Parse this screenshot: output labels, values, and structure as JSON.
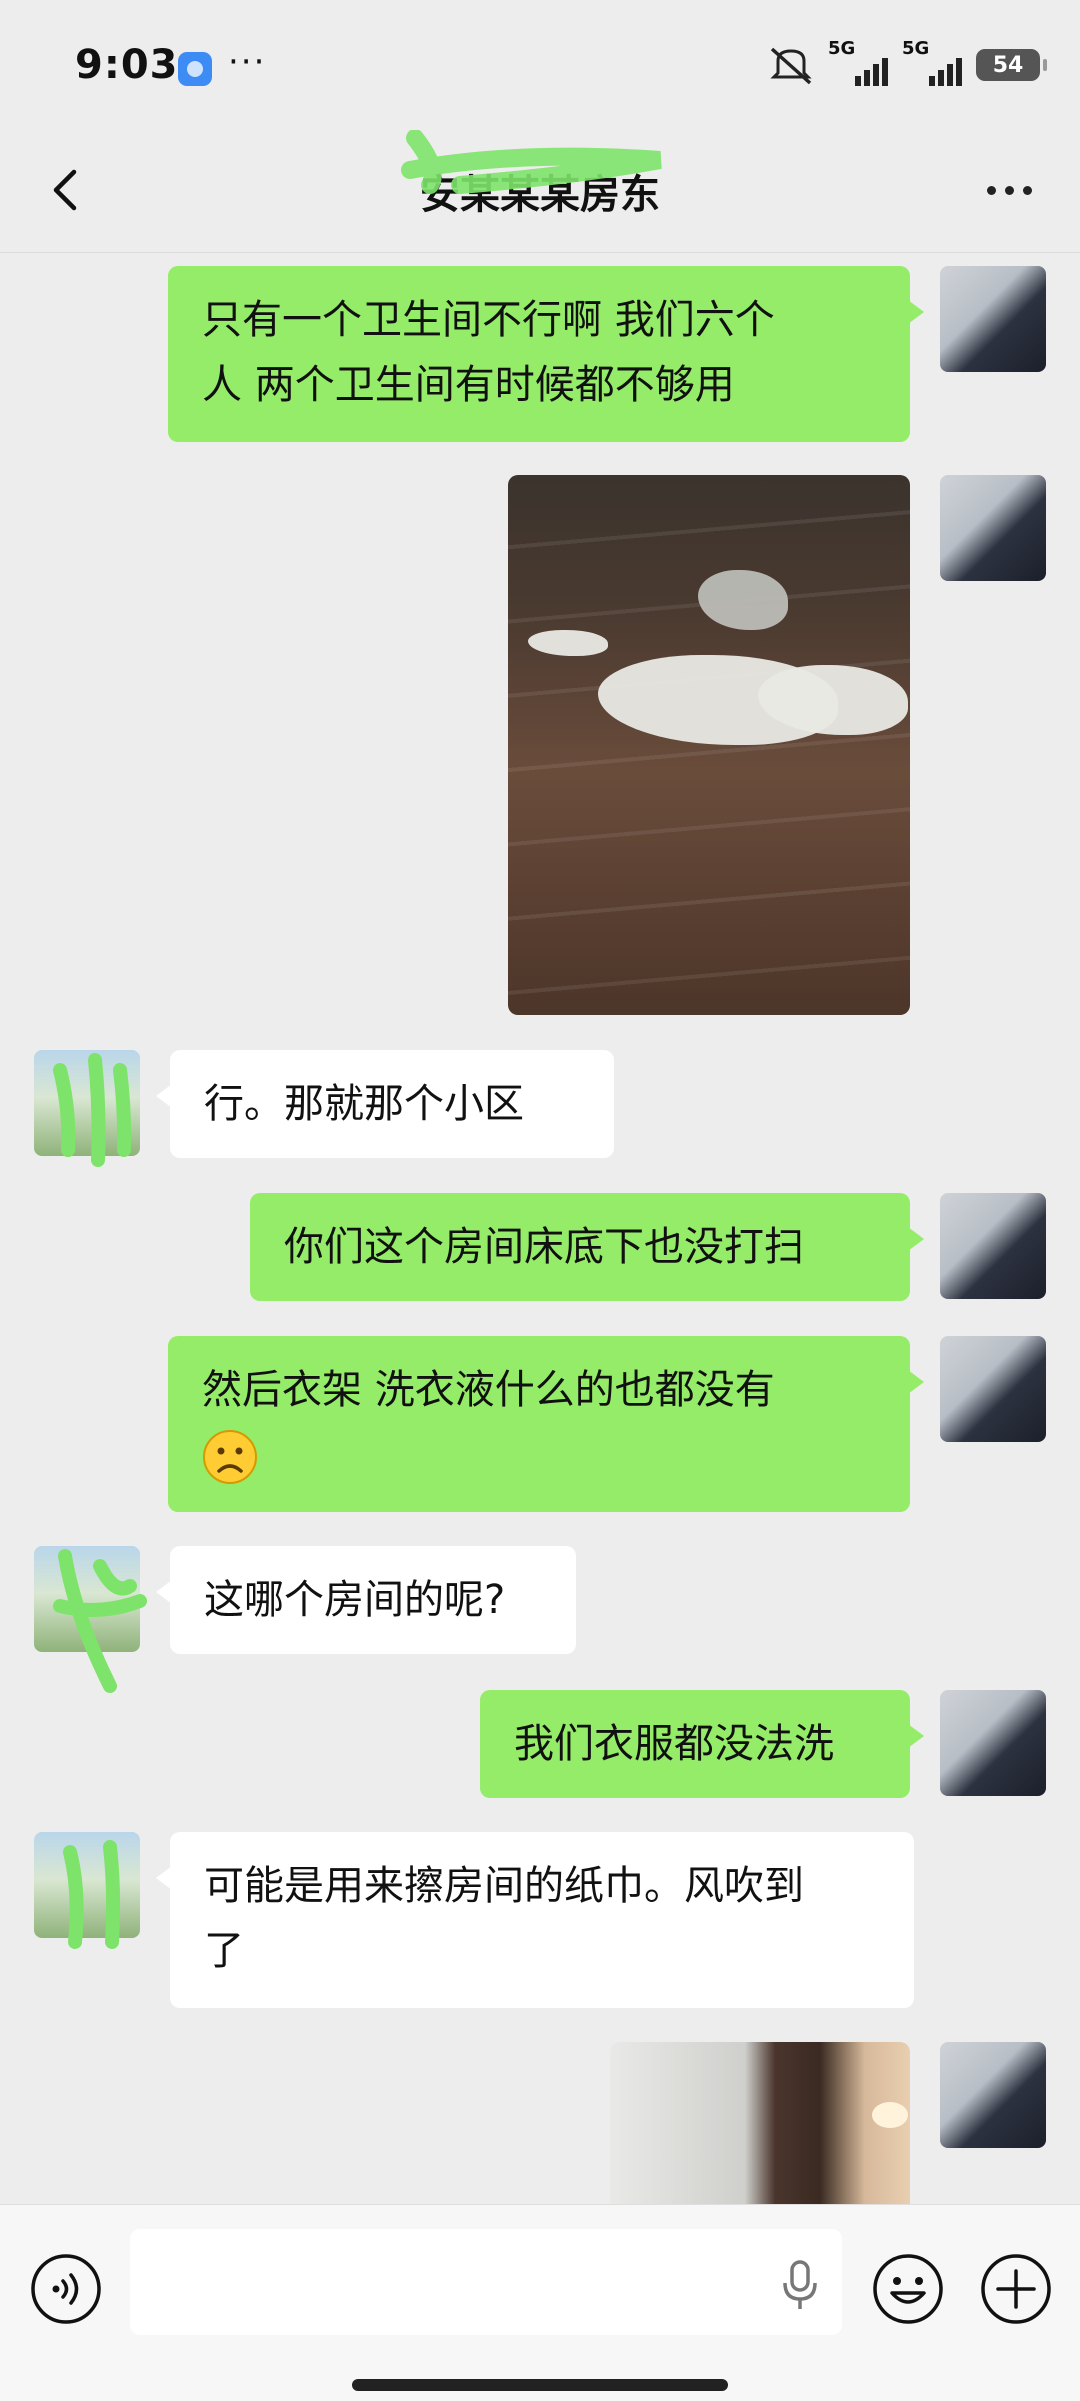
{
  "status_bar": {
    "time": "9:03",
    "overflow": "···",
    "signal1_label": "5G",
    "signal2_label": "5G",
    "battery": "54"
  },
  "header": {
    "title": "安某某某房东",
    "back_icon": "chevron-left-icon",
    "menu_icon": "more-horizontal-icon"
  },
  "messages": [
    {
      "side": "me",
      "type": "text",
      "line1": "只有一个卫生间不行啊 我们六个",
      "line2": "人 两个卫生间有时候都不够用"
    },
    {
      "side": "me",
      "type": "image",
      "subject": "tissue scraps on wooden floor"
    },
    {
      "side": "other",
      "type": "text",
      "text": "行。那就那个小区"
    },
    {
      "side": "me",
      "type": "text",
      "text": "你们这个房间床底下也没打扫"
    },
    {
      "side": "me",
      "type": "text",
      "line1": "然后衣架 洗衣液什么的也都没有",
      "emoji": "frowning-face-icon"
    },
    {
      "side": "other",
      "type": "text",
      "text": "这哪个房间的呢?"
    },
    {
      "side": "me",
      "type": "text",
      "text": "我们衣服都没法洗"
    },
    {
      "side": "other",
      "type": "text",
      "line1": "可能是用来擦房间的纸巾。风吹到",
      "line2": "了"
    },
    {
      "side": "me",
      "type": "image",
      "subject": "room interior"
    }
  ],
  "input_bar": {
    "voice_icon": "voice-mode-icon",
    "mic_icon": "microphone-icon",
    "emoji_icon": "smiley-icon",
    "plus_icon": "plus-circle-icon"
  },
  "colors": {
    "background": "#ededed",
    "my_bubble": "#95ec69",
    "other_bubble": "#ffffff",
    "censor_mark": "#7ee36a"
  }
}
